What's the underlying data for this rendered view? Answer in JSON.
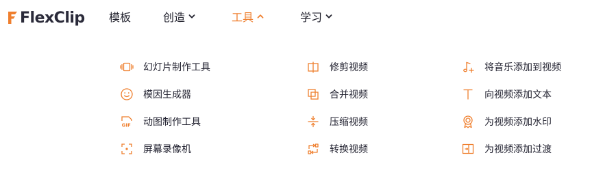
{
  "brand": {
    "name": "FlexClip",
    "accent_color": "#ef7f2e",
    "text_color": "#2b2b3a"
  },
  "nav": {
    "items": [
      {
        "label": "模板",
        "has_dropdown": false,
        "active": false
      },
      {
        "label": "创造",
        "has_dropdown": true,
        "active": false
      },
      {
        "label": "工具",
        "has_dropdown": true,
        "active": true
      },
      {
        "label": "学习",
        "has_dropdown": true,
        "active": false
      }
    ]
  },
  "tools_menu": {
    "columns": [
      [
        {
          "label": "幻灯片制作工具",
          "icon": "slideshow-icon"
        },
        {
          "label": "模因生成器",
          "icon": "smiley-icon"
        },
        {
          "label": "动图制作工具",
          "icon": "gif-icon"
        },
        {
          "label": "屏幕录像机",
          "icon": "screen-record-icon"
        }
      ],
      [
        {
          "label": "修剪视频",
          "icon": "trim-icon"
        },
        {
          "label": "合并视频",
          "icon": "merge-icon"
        },
        {
          "label": "压缩视频",
          "icon": "compress-icon"
        },
        {
          "label": "转换视频",
          "icon": "convert-icon"
        }
      ],
      [
        {
          "label": "将音乐添加到视频",
          "icon": "music-add-icon"
        },
        {
          "label": "向视频添加文本",
          "icon": "text-icon"
        },
        {
          "label": "为视频添加水印",
          "icon": "watermark-badge-icon"
        },
        {
          "label": "为视频添加过渡",
          "icon": "transition-icon"
        }
      ]
    ]
  }
}
